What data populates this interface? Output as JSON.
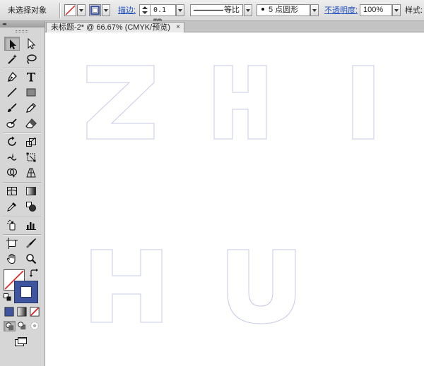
{
  "control_bar": {
    "selection_status": "未选择对象",
    "stroke_label": "描边:",
    "stroke_weight": "0.1 mm",
    "stroke_profile": "等比",
    "brush": "5 点圆形",
    "opacity_label": "不透明度:",
    "opacity_value": "100%",
    "style_label": "样式:"
  },
  "document": {
    "tab_title": "未标题-2* @ 66.67% (CMYK/预览)",
    "close_glyph": "×"
  },
  "artwork": {
    "row1": [
      "Z",
      "H",
      "I"
    ],
    "row2": [
      "H",
      "U"
    ],
    "outline_color": "#c5c9e6"
  },
  "colors": {
    "fill_none_stroke": "#e02020",
    "stroke_swatch": "#3f55a0",
    "panel_bg": "#d6d6d6"
  }
}
